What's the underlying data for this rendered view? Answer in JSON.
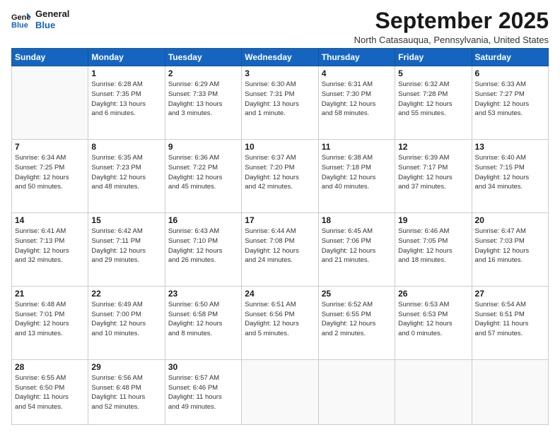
{
  "logo": {
    "line1": "General",
    "line2": "Blue"
  },
  "title": "September 2025",
  "subtitle": "North Catasauqua, Pennsylvania, United States",
  "days_of_week": [
    "Sunday",
    "Monday",
    "Tuesday",
    "Wednesday",
    "Thursday",
    "Friday",
    "Saturday"
  ],
  "weeks": [
    [
      {
        "day": "",
        "info": ""
      },
      {
        "day": "1",
        "info": "Sunrise: 6:28 AM\nSunset: 7:35 PM\nDaylight: 13 hours\nand 6 minutes."
      },
      {
        "day": "2",
        "info": "Sunrise: 6:29 AM\nSunset: 7:33 PM\nDaylight: 13 hours\nand 3 minutes."
      },
      {
        "day": "3",
        "info": "Sunrise: 6:30 AM\nSunset: 7:31 PM\nDaylight: 13 hours\nand 1 minute."
      },
      {
        "day": "4",
        "info": "Sunrise: 6:31 AM\nSunset: 7:30 PM\nDaylight: 12 hours\nand 58 minutes."
      },
      {
        "day": "5",
        "info": "Sunrise: 6:32 AM\nSunset: 7:28 PM\nDaylight: 12 hours\nand 55 minutes."
      },
      {
        "day": "6",
        "info": "Sunrise: 6:33 AM\nSunset: 7:27 PM\nDaylight: 12 hours\nand 53 minutes."
      }
    ],
    [
      {
        "day": "7",
        "info": "Sunrise: 6:34 AM\nSunset: 7:25 PM\nDaylight: 12 hours\nand 50 minutes."
      },
      {
        "day": "8",
        "info": "Sunrise: 6:35 AM\nSunset: 7:23 PM\nDaylight: 12 hours\nand 48 minutes."
      },
      {
        "day": "9",
        "info": "Sunrise: 6:36 AM\nSunset: 7:22 PM\nDaylight: 12 hours\nand 45 minutes."
      },
      {
        "day": "10",
        "info": "Sunrise: 6:37 AM\nSunset: 7:20 PM\nDaylight: 12 hours\nand 42 minutes."
      },
      {
        "day": "11",
        "info": "Sunrise: 6:38 AM\nSunset: 7:18 PM\nDaylight: 12 hours\nand 40 minutes."
      },
      {
        "day": "12",
        "info": "Sunrise: 6:39 AM\nSunset: 7:17 PM\nDaylight: 12 hours\nand 37 minutes."
      },
      {
        "day": "13",
        "info": "Sunrise: 6:40 AM\nSunset: 7:15 PM\nDaylight: 12 hours\nand 34 minutes."
      }
    ],
    [
      {
        "day": "14",
        "info": "Sunrise: 6:41 AM\nSunset: 7:13 PM\nDaylight: 12 hours\nand 32 minutes."
      },
      {
        "day": "15",
        "info": "Sunrise: 6:42 AM\nSunset: 7:11 PM\nDaylight: 12 hours\nand 29 minutes."
      },
      {
        "day": "16",
        "info": "Sunrise: 6:43 AM\nSunset: 7:10 PM\nDaylight: 12 hours\nand 26 minutes."
      },
      {
        "day": "17",
        "info": "Sunrise: 6:44 AM\nSunset: 7:08 PM\nDaylight: 12 hours\nand 24 minutes."
      },
      {
        "day": "18",
        "info": "Sunrise: 6:45 AM\nSunset: 7:06 PM\nDaylight: 12 hours\nand 21 minutes."
      },
      {
        "day": "19",
        "info": "Sunrise: 6:46 AM\nSunset: 7:05 PM\nDaylight: 12 hours\nand 18 minutes."
      },
      {
        "day": "20",
        "info": "Sunrise: 6:47 AM\nSunset: 7:03 PM\nDaylight: 12 hours\nand 16 minutes."
      }
    ],
    [
      {
        "day": "21",
        "info": "Sunrise: 6:48 AM\nSunset: 7:01 PM\nDaylight: 12 hours\nand 13 minutes."
      },
      {
        "day": "22",
        "info": "Sunrise: 6:49 AM\nSunset: 7:00 PM\nDaylight: 12 hours\nand 10 minutes."
      },
      {
        "day": "23",
        "info": "Sunrise: 6:50 AM\nSunset: 6:58 PM\nDaylight: 12 hours\nand 8 minutes."
      },
      {
        "day": "24",
        "info": "Sunrise: 6:51 AM\nSunset: 6:56 PM\nDaylight: 12 hours\nand 5 minutes."
      },
      {
        "day": "25",
        "info": "Sunrise: 6:52 AM\nSunset: 6:55 PM\nDaylight: 12 hours\nand 2 minutes."
      },
      {
        "day": "26",
        "info": "Sunrise: 6:53 AM\nSunset: 6:53 PM\nDaylight: 12 hours\nand 0 minutes."
      },
      {
        "day": "27",
        "info": "Sunrise: 6:54 AM\nSunset: 6:51 PM\nDaylight: 11 hours\nand 57 minutes."
      }
    ],
    [
      {
        "day": "28",
        "info": "Sunrise: 6:55 AM\nSunset: 6:50 PM\nDaylight: 11 hours\nand 54 minutes."
      },
      {
        "day": "29",
        "info": "Sunrise: 6:56 AM\nSunset: 6:48 PM\nDaylight: 11 hours\nand 52 minutes."
      },
      {
        "day": "30",
        "info": "Sunrise: 6:57 AM\nSunset: 6:46 PM\nDaylight: 11 hours\nand 49 minutes."
      },
      {
        "day": "",
        "info": ""
      },
      {
        "day": "",
        "info": ""
      },
      {
        "day": "",
        "info": ""
      },
      {
        "day": "",
        "info": ""
      }
    ]
  ]
}
